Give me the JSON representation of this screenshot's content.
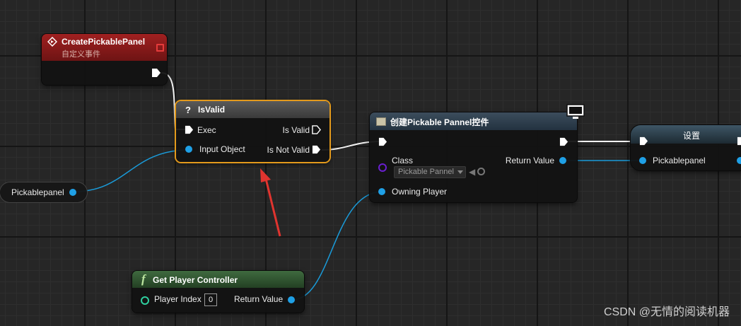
{
  "event_node": {
    "title": "CreatePickablePanel",
    "subtitle": "自定义事件"
  },
  "isvalid_node": {
    "title": "IsValid",
    "title_icon": "?",
    "exec_label": "Exec",
    "input_label": "Input Object",
    "valid_label": "Is Valid",
    "not_valid_label": "Is Not Valid"
  },
  "var_node": {
    "label": "Pickablepanel"
  },
  "create_node": {
    "title": "创建Pickable Pannel控件",
    "class_label": "Class",
    "class_value": "Pickable Pannel",
    "return_label": "Return Value",
    "owning_label": "Owning Player"
  },
  "set_node": {
    "title": "设置",
    "pin_label": "Pickablepanel"
  },
  "getpc_node": {
    "title": "Get Player Controller",
    "title_icon": "f",
    "index_label": "Player Index",
    "index_value": "0",
    "return_label": "Return Value"
  },
  "watermark": "CSDN @无情的阅读机器",
  "colors": {
    "event_header": "#8a1a1a",
    "isvalid_highlight": "#e39a1c",
    "object_pin": "#1fa0e6",
    "class_pin": "#6a1fd0",
    "function_header": "#2c5a2c",
    "arrow": "#e0342f"
  }
}
